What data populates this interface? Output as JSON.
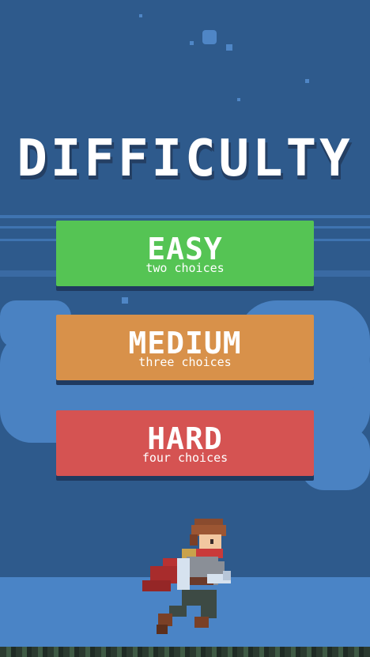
{
  "screen": {
    "title": "DIFFICULTY"
  },
  "buttons": [
    {
      "label": "EASY",
      "sub": "two choices",
      "color": "#55c454"
    },
    {
      "label": "MEDIUM",
      "sub": "three choices",
      "color": "#d8914a"
    },
    {
      "label": "HARD",
      "sub": "four choices",
      "color": "#d55352"
    }
  ],
  "colors": {
    "background": "#2e5a8c",
    "cloud": "#4a82c2",
    "ground": "#4a84c6"
  }
}
